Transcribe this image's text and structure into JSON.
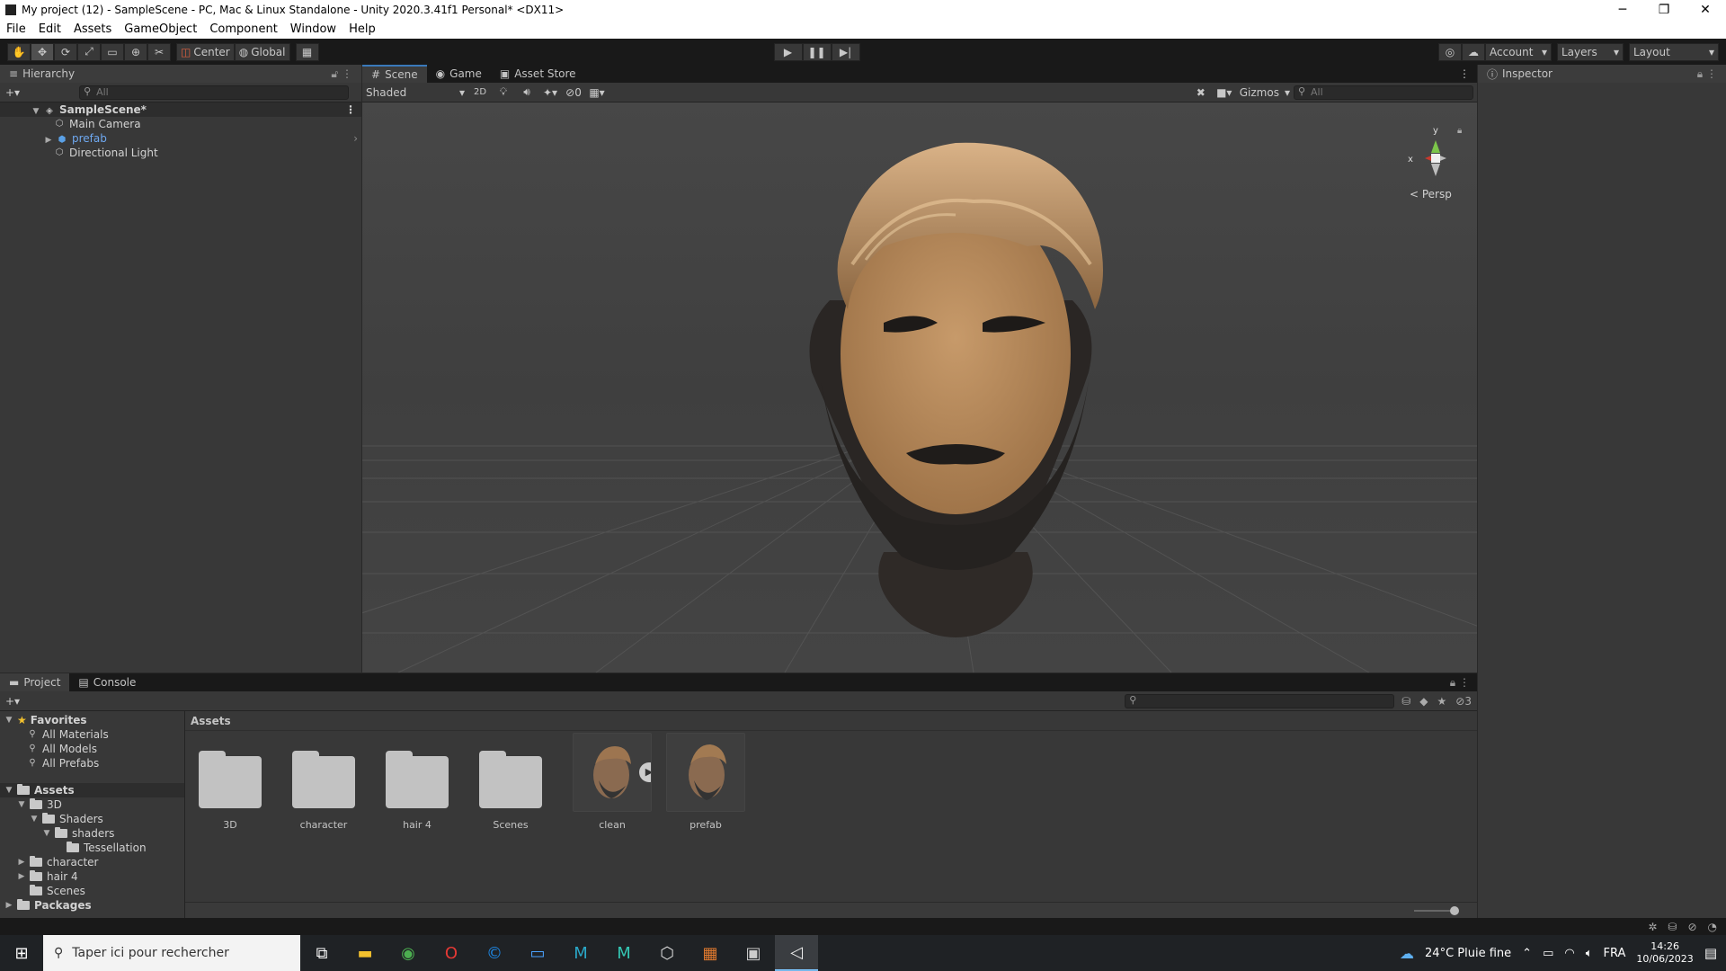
{
  "window": {
    "title": "My project (12) - SampleScene - PC, Mac & Linux Standalone - Unity 2020.3.41f1 Personal* <DX11>",
    "minimize": "─",
    "restore": "❐",
    "close": "✕"
  },
  "menu": [
    "File",
    "Edit",
    "Assets",
    "GameObject",
    "Component",
    "Window",
    "Help"
  ],
  "toolbar": {
    "pivot": "Center",
    "space": "Global",
    "account": "Account",
    "layers": "Layers",
    "layout": "Layout"
  },
  "hierarchy": {
    "tab": "Hierarchy",
    "search_placeholder": "All",
    "scene": "SampleScene*",
    "items": [
      "Main Camera",
      "prefab",
      "Directional Light"
    ]
  },
  "scene_view": {
    "tabs": [
      "Scene",
      "Game",
      "Asset Store"
    ],
    "draw_mode": "Shaded",
    "mode_2d": "2D",
    "hidden_count": "0",
    "gizmos": "Gizmos",
    "search_placeholder": "All",
    "persp": "< Persp",
    "axis_x": "x",
    "axis_y": "y"
  },
  "inspector": {
    "tab": "Inspector"
  },
  "project": {
    "tabs": [
      "Project",
      "Console"
    ],
    "breadcrumb": "Assets",
    "hidden_count": "3",
    "favorites_label": "Favorites",
    "favorites": [
      "All Materials",
      "All Models",
      "All Prefabs"
    ],
    "tree": {
      "assets": "Assets",
      "d3": "3D",
      "shaders_upper": "Shaders",
      "shaders_lower": "shaders",
      "tessellation": "Tessellation",
      "character": "character",
      "hair4": "hair 4",
      "scenes": "Scenes",
      "packages": "Packages"
    },
    "assets": [
      "3D",
      "character",
      "hair 4",
      "Scenes",
      "clean",
      "prefab"
    ]
  },
  "taskbar": {
    "search_placeholder": "Taper ici pour rechercher",
    "weather": "24°C Pluie fine",
    "lang": "FRA",
    "time": "14:26",
    "date": "10/06/2023"
  },
  "colors": {
    "accent": "#3a79bb",
    "panel": "#383838",
    "toolbar": "#191919",
    "selection": "#2c5d87"
  }
}
